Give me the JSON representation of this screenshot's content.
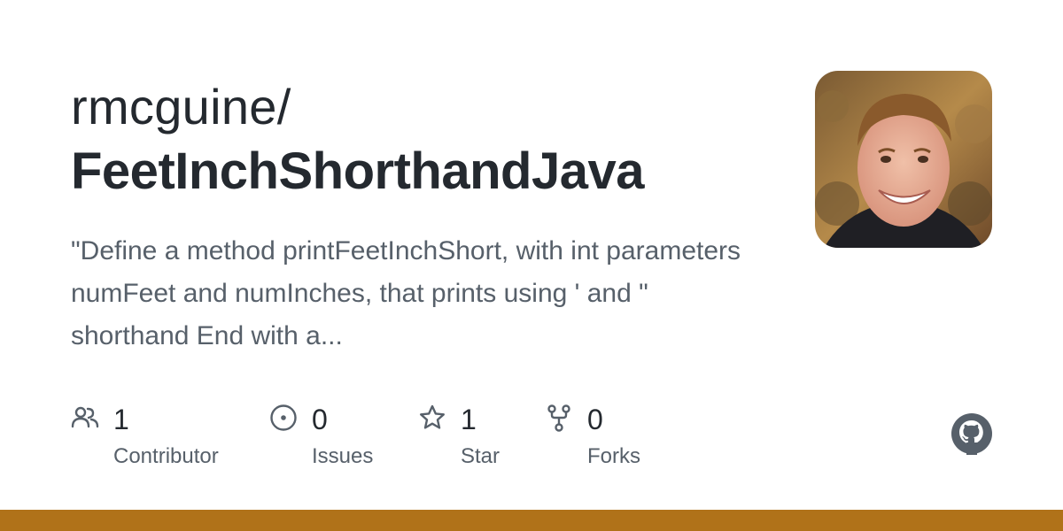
{
  "repo": {
    "owner": "rmcguine/",
    "name": "FeetInchShorthandJava",
    "description": "\"Define a method printFeetInchShort, with int parameters numFeet and numInches, that prints using ' and \" shorthand End with a..."
  },
  "stats": [
    {
      "icon": "people-icon",
      "value": "1",
      "label": "Contributor"
    },
    {
      "icon": "issue-circle-icon",
      "value": "0",
      "label": "Issues"
    },
    {
      "icon": "star-icon",
      "value": "1",
      "label": "Star"
    },
    {
      "icon": "fork-icon",
      "value": "0",
      "label": "Forks"
    }
  ],
  "colors": {
    "text_primary": "#24292f",
    "text_secondary": "#57606a",
    "language_bar": "#b07219"
  }
}
